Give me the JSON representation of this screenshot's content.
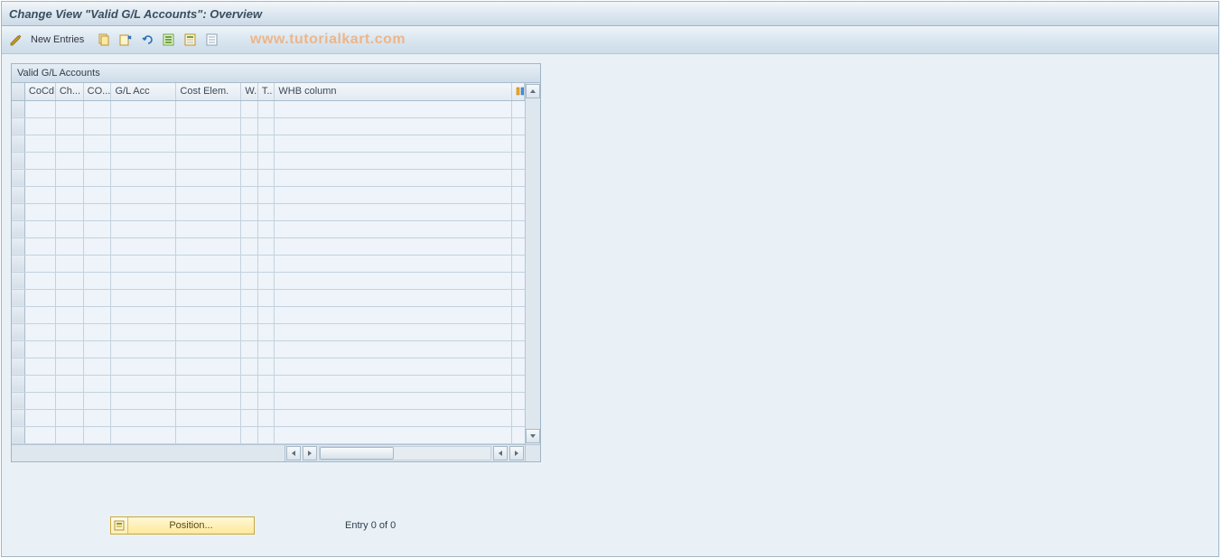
{
  "header": {
    "title": "Change View \"Valid G/L Accounts\": Overview"
  },
  "toolbar": {
    "new_entries_label": "New Entries",
    "icons": {
      "toggle": "toggle-display-change-icon",
      "copy": "copy-icon",
      "delete": "delete-icon",
      "undo": "undo-icon",
      "select_all": "select-all-icon",
      "select_block": "select-block-icon",
      "deselect_all": "deselect-all-icon"
    }
  },
  "watermark": "www.tutorialkart.com",
  "grid": {
    "title": "Valid G/L Accounts",
    "columns": {
      "cocd": "CoCd",
      "ch": "Ch...",
      "co": "CO...",
      "gl_acc": "G/L Acc",
      "cost_elem": "Cost Elem.",
      "w": "W.",
      "t": "T..",
      "whb": "WHB column"
    },
    "rows": [
      {},
      {},
      {},
      {},
      {},
      {},
      {},
      {},
      {},
      {},
      {},
      {},
      {},
      {},
      {},
      {},
      {},
      {},
      {},
      {}
    ]
  },
  "footer": {
    "position_label": "Position...",
    "entry_text": "Entry 0 of 0"
  }
}
